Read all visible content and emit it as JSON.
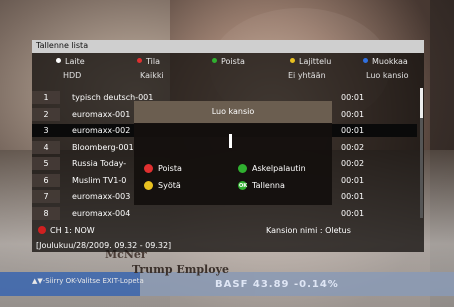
{
  "window_title": "Tallenne lista",
  "function_keys": [
    {
      "label": "Laite",
      "color": "#ffffff"
    },
    {
      "label": "Tila",
      "color": "#e03030"
    },
    {
      "label": "Poista",
      "color": "#30b030"
    },
    {
      "label": "Lajittelu",
      "color": "#e8c020"
    },
    {
      "label": "Muokkaa",
      "color": "#3070e0"
    }
  ],
  "sub_labels": [
    "HDD",
    "Kaikki",
    "Ei yhtään",
    "Luo kansio"
  ],
  "recordings": [
    {
      "num": "1",
      "name": "typisch deutsch-001",
      "time": "00:01"
    },
    {
      "num": "2",
      "name": "euromaxx-001",
      "time": "00:01"
    },
    {
      "num": "3",
      "name": "euromaxx-002",
      "time": "00:01"
    },
    {
      "num": "4",
      "name": "Bloomberg-001",
      "time": "00:02"
    },
    {
      "num": "5",
      "name": "Russia Today-",
      "time": "00:02"
    },
    {
      "num": "6",
      "name": "Muslim TV1-0",
      "time": "00:01"
    },
    {
      "num": "7",
      "name": "euromaxx-003",
      "time": "00:01"
    },
    {
      "num": "8",
      "name": "euromaxx-004",
      "time": "00:01"
    }
  ],
  "dialog": {
    "title": "Luo kansio",
    "options": [
      {
        "label": "Poista",
        "color": "#e03030"
      },
      {
        "label": "Askelpalautin",
        "color": "#30b030"
      },
      {
        "label": "Syötä",
        "color": "#e8c020"
      },
      {
        "label": "Tallenna",
        "color": "#30b030",
        "badge": "OK"
      }
    ]
  },
  "channel": "CH 1: NOW",
  "folder_name": "Kansion nimi : Oletus",
  "date_range": "[Joulukuu/28/2009. 09.32 - 09.32]",
  "hint": "▲▼-Siirry  OK-Valitse  EXIT-Lopeta",
  "background": {
    "ticker": "BASF 43.89 -0.14%",
    "name": "McNer",
    "role": "Trump Employe"
  }
}
